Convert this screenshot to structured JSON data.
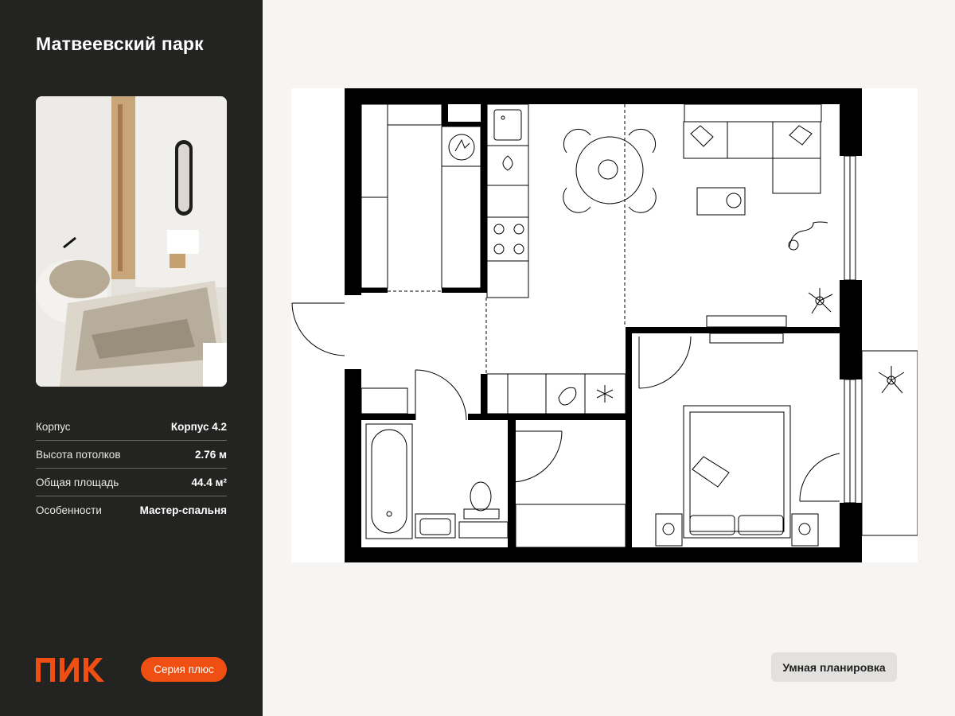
{
  "project": {
    "title": "Матвеевский парк"
  },
  "specs": [
    {
      "label": "Корпус",
      "value": "Корпус 4.2"
    },
    {
      "label": "Высота потолков",
      "value": "2.76 м"
    },
    {
      "label": "Общая площадь",
      "value": "44.4 м²"
    },
    {
      "label": "Особенности",
      "value": "Мастер-спальня"
    }
  ],
  "brand": {
    "logo_text": "ПИК",
    "series_label": "Серия плюс",
    "accent_color": "#ef4f12"
  },
  "badge": {
    "label": "Умная планировка"
  },
  "colors": {
    "sidebar_bg": "#232322",
    "page_bg": "#f6f5f3",
    "wall": "#000000"
  },
  "icons": {
    "bathroom": [
      "bathtub-icon",
      "toilet-icon",
      "sink-icon"
    ],
    "kitchen": [
      "cooktop-icon",
      "sink-icon",
      "washing-machine-icon",
      "fridge-icon"
    ],
    "living": [
      "dining-table-icon",
      "sofa-icon",
      "cat-icon",
      "plant-icon",
      "tv-icon"
    ],
    "bedroom": [
      "bed-icon",
      "nightstand-icon",
      "plant-icon"
    ]
  }
}
